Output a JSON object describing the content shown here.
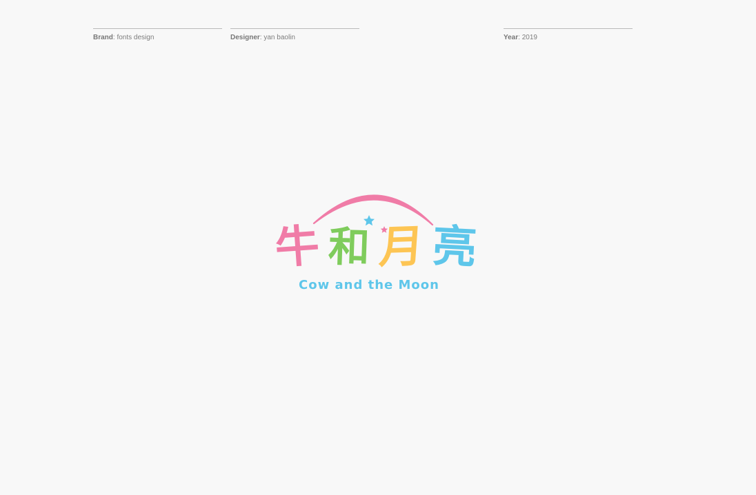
{
  "meta": {
    "brand": {
      "key": "Brand",
      "value": ": fonts design"
    },
    "designer": {
      "key": "Designer",
      "value": ": yan baolin"
    },
    "year": {
      "key": "Year",
      "value": ": 2019"
    }
  },
  "logo": {
    "chars": [
      "牛",
      "和",
      "月",
      "亮"
    ],
    "subtitle": "Cow and the Moon",
    "colors": {
      "pink": "#f07ca7",
      "green": "#7fcc5c",
      "yellow": "#fdc554",
      "blue": "#5ec6ea"
    },
    "icons": [
      "arc-icon",
      "blue-star-icon",
      "pink-star-icon"
    ]
  }
}
